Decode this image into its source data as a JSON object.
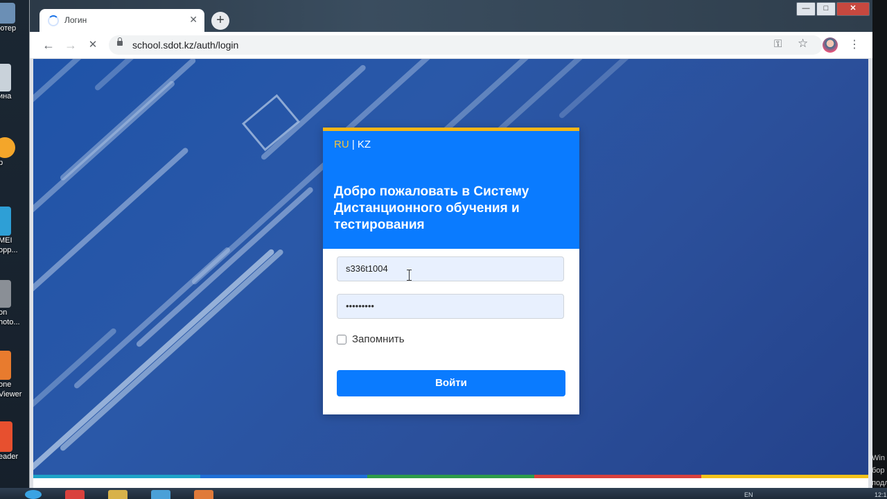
{
  "desktop": {
    "icons": [
      {
        "label": "ютер",
        "color": "#6b8fb5"
      },
      {
        "label": "ина",
        "color": "#c9d2da"
      },
      {
        "label": "р",
        "color": "#f4a62a"
      },
      {
        "label": "MEI\nорр...",
        "color": "#2e9fd6"
      },
      {
        "label": "on\nhoto...",
        "color": "#8a8f96"
      },
      {
        "label": "one\nViewer",
        "color": "#e87b2e"
      },
      {
        "label": "eader",
        "color": "#e7502f"
      }
    ],
    "right_text": [
      "Win",
      "бор",
      "подл"
    ]
  },
  "browser": {
    "tab": {
      "title": "Логин"
    },
    "new_tab_label": "+",
    "window_controls": {
      "minimize": "—",
      "maximize": "□",
      "close": "✕"
    },
    "toolbar": {
      "back_icon": "←",
      "forward_icon": "→",
      "stop_icon": "✕",
      "url": "school.sdot.kz/auth/login",
      "key_icon": "⚿",
      "star_icon": "☆",
      "menu_icon": "⋮"
    }
  },
  "login": {
    "lang": {
      "ru": "RU",
      "separator": " | ",
      "kz": "KZ"
    },
    "welcome": "Добро пожаловать в Систему Дистанционного обучения и тестирования",
    "username_value": "s336t1004",
    "password_value": "•••••••••",
    "remember_label": "Запомнить",
    "remember_checked": false,
    "submit_label": "Войти"
  },
  "colors": {
    "accent": "#0a7bff",
    "header_border": "#f4b617",
    "lang_active": "#f4c43a",
    "stripe": [
      "#1fa3c8",
      "#1f6fd6",
      "#2e9c4a",
      "#d9413d",
      "#f4c21a"
    ]
  },
  "taskbar": {
    "items": [
      "#d9413d",
      "#d8b24a",
      "#4aa0d8",
      "#e07a3a"
    ],
    "tray": {
      "lang": "EN",
      "time": "12:1"
    }
  }
}
